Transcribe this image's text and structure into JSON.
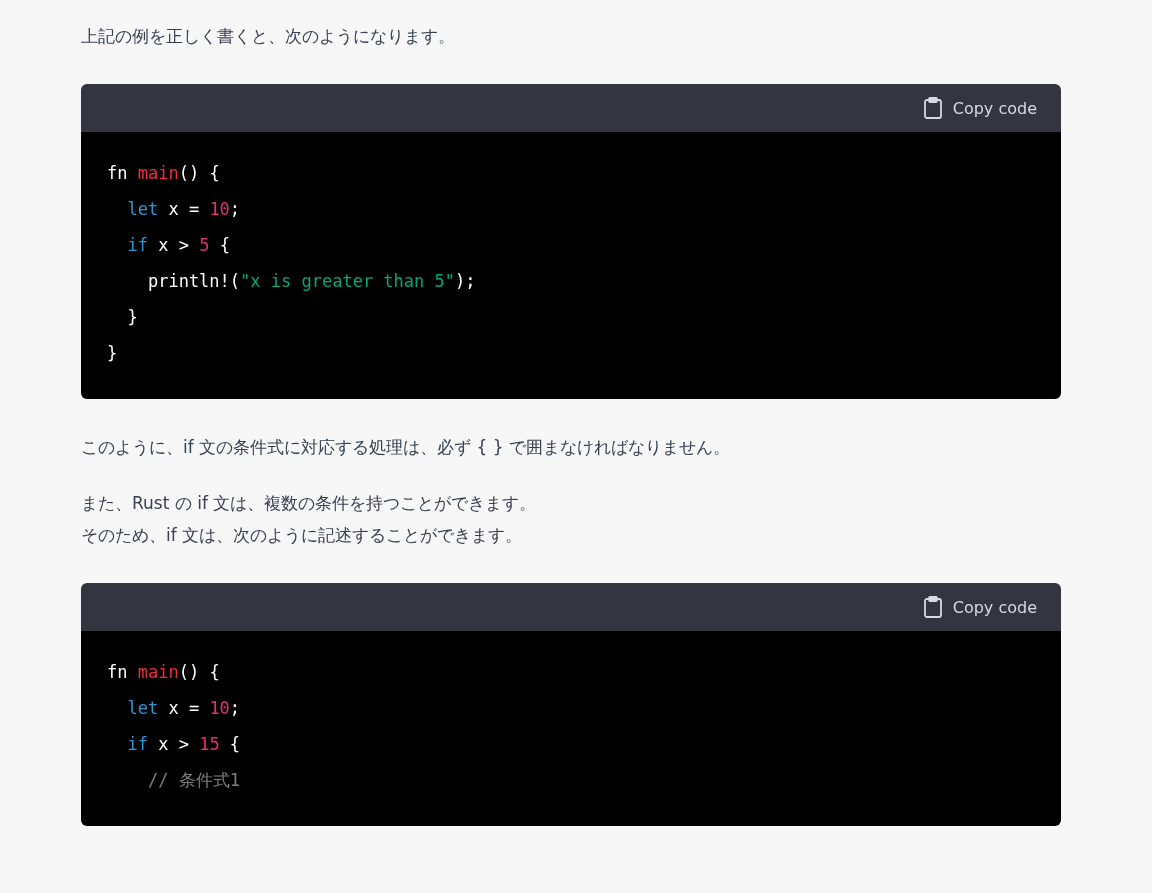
{
  "blocks": [
    {
      "kind": "text",
      "lines": [
        "上記の例を正しく書くと、次のようになります。"
      ]
    },
    {
      "kind": "code",
      "copy_label": "Copy code",
      "lines": [
        [
          {
            "text": "fn ",
            "kind": "plain"
          },
          {
            "text": "main",
            "kind": "func"
          },
          {
            "text": "() {",
            "kind": "plain"
          }
        ],
        [
          {
            "text": "  let",
            "kind": "keyword"
          },
          {
            "text": " x = ",
            "kind": "plain"
          },
          {
            "text": "10",
            "kind": "number"
          },
          {
            "text": ";",
            "kind": "plain"
          }
        ],
        [
          {
            "text": "  if",
            "kind": "keyword"
          },
          {
            "text": " x > ",
            "kind": "plain"
          },
          {
            "text": "5",
            "kind": "number"
          },
          {
            "text": " {",
            "kind": "plain"
          }
        ],
        [
          {
            "text": "    println!(",
            "kind": "plain"
          },
          {
            "text": "\"x is greater than 5\"",
            "kind": "string"
          },
          {
            "text": ");",
            "kind": "plain"
          }
        ],
        [
          {
            "text": "  }",
            "kind": "plain"
          }
        ],
        [
          {
            "text": "}",
            "kind": "plain"
          }
        ]
      ]
    },
    {
      "kind": "text",
      "lines": [
        "このように、if 文の条件式に対応する処理は、必ず { } で囲まなければなりません。"
      ]
    },
    {
      "kind": "text",
      "lines": [
        "また、Rust の if 文は、複数の条件を持つことができます。",
        "そのため、if 文は、次のように記述することができます。"
      ]
    },
    {
      "kind": "code",
      "copy_label": "Copy code",
      "lines": [
        [
          {
            "text": "fn ",
            "kind": "plain"
          },
          {
            "text": "main",
            "kind": "func"
          },
          {
            "text": "() {",
            "kind": "plain"
          }
        ],
        [
          {
            "text": "  let",
            "kind": "keyword"
          },
          {
            "text": " x = ",
            "kind": "plain"
          },
          {
            "text": "10",
            "kind": "number"
          },
          {
            "text": ";",
            "kind": "plain"
          }
        ],
        [
          {
            "text": "  if",
            "kind": "keyword"
          },
          {
            "text": " x > ",
            "kind": "plain"
          },
          {
            "text": "15",
            "kind": "number"
          },
          {
            "text": " {",
            "kind": "plain"
          }
        ],
        [
          {
            "text": "    // 条件式1",
            "kind": "comment"
          }
        ]
      ]
    }
  ]
}
